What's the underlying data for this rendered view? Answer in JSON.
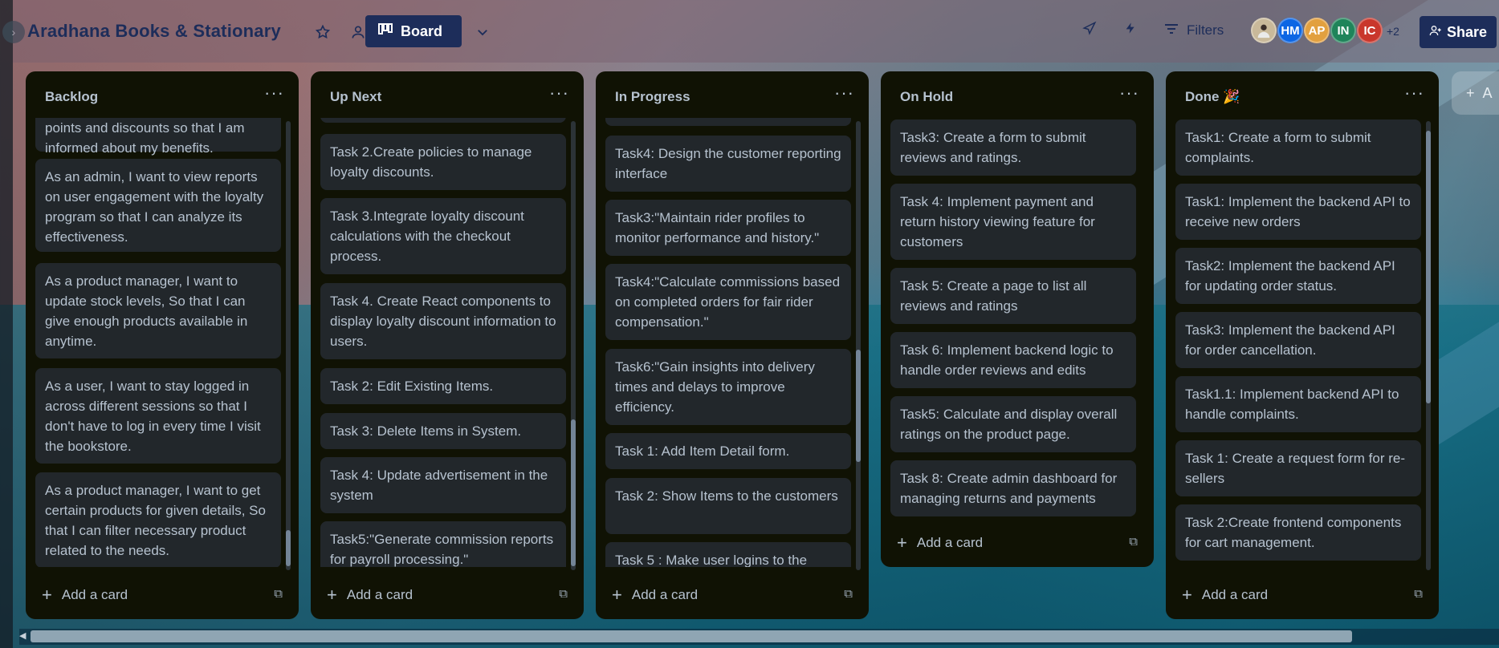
{
  "board": {
    "title": "Aradhana Books & Stationary",
    "view_label": "Board",
    "filters_label": "Filters",
    "share_label": "Share",
    "members_more": "+2",
    "avatars": [
      {
        "initials": "",
        "color": "#c9b99a"
      },
      {
        "initials": "HM",
        "color": "#0c66e4"
      },
      {
        "initials": "AP",
        "color": "#e2a03f"
      },
      {
        "initials": "IN",
        "color": "#1f845a"
      },
      {
        "initials": "IC",
        "color": "#c9372c"
      }
    ],
    "add_list_label": "A"
  },
  "lists": [
    {
      "title": "Backlog",
      "add_card_label": "Add a card",
      "cards": [
        "points and discounts so that I am informed about my benefits.",
        "As an admin, I want to view reports on user engagement with the loyalty program so that I can analyze its effectiveness.",
        "As a product manager, I want to update stock levels, So that I can give enough products available in anytime.",
        "As a user, I want to stay logged in across different sessions so that I don't have to log in every time I visit the bookstore.",
        "As a product manager, I want to get certain products for given details, So that I can filter necessary product related to the needs."
      ]
    },
    {
      "title": "Up Next",
      "add_card_label": "Add a card",
      "cards": [
        "",
        "Task 2.Create policies to manage loyalty discounts.",
        "Task 3.Integrate loyalty discount calculations with the checkout process.",
        "Task 4. Create React components to display loyalty discount information to users.",
        "Task 2: Edit Existing Items.",
        "Task 3: Delete Items in System.",
        "Task 4: Update advertisement in the system",
        "Task5:\"Generate commission reports for payroll processing.\""
      ]
    },
    {
      "title": "In Progress",
      "add_card_label": "Add a card",
      "cards": [
        "",
        "Task4: Design the customer reporting interface",
        "Task3:\"Maintain rider profiles to monitor performance and history.\"",
        "Task4:\"Calculate commissions based on completed orders for fair rider compensation.\"",
        "Task6:\"Gain insights into delivery times and delays to improve efficiency.",
        "Task 1: Add Item Detail form.",
        "Task 2: Show Items to the customers",
        "Task 5 : Make user logins to the"
      ]
    },
    {
      "title": "On Hold",
      "add_card_label": "Add a card",
      "cards": [
        "Task3: Create a form to submit reviews and ratings.",
        "Task 4: Implement payment and return history viewing feature for customers",
        "Task 5: Create a page to list all reviews and ratings",
        "Task 6: Implement backend logic to handle order reviews and edits",
        "Task5: Calculate and display overall ratings on the product page.",
        "Task 8: Create admin dashboard for managing returns and payments"
      ]
    },
    {
      "title": "Done 🎉",
      "add_card_label": "Add a card",
      "cards": [
        "Task1: Create a form to submit complaints.",
        "Task1: Implement the backend API to receive new orders",
        "Task2: Implement the backend API for updating order status.",
        "Task3: Implement the backend API for order cancellation.",
        "Task1.1: Implement backend API to handle complaints.",
        "Task 1: Create a request form for re-sellers",
        "Task 2:Create frontend components for cart management."
      ]
    }
  ]
}
